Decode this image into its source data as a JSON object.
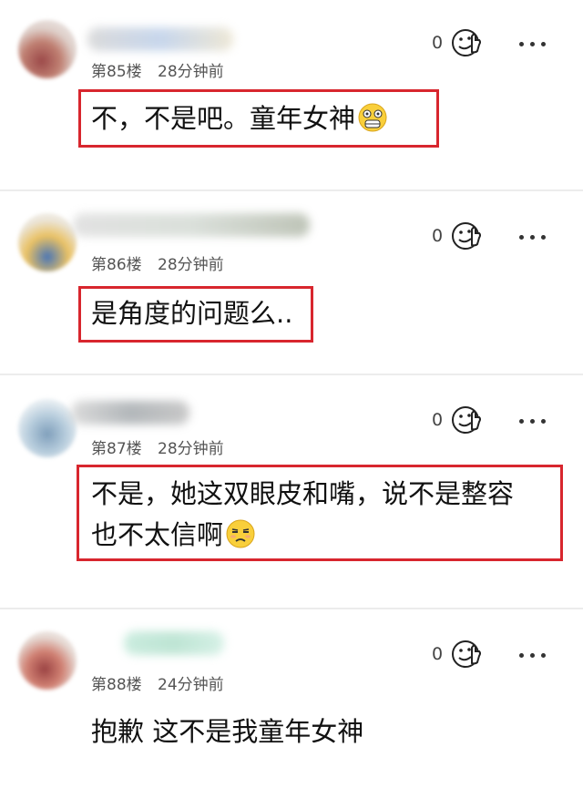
{
  "comments": [
    {
      "floor": "第85楼",
      "time": "28分钟前",
      "likes": "0",
      "lines": [
        "不，不是吧。童年女神"
      ],
      "emoji": "scared-face",
      "highlighted": true
    },
    {
      "floor": "第86楼",
      "time": "28分钟前",
      "likes": "0",
      "lines": [
        "是角度的问题么.."
      ],
      "emoji": null,
      "highlighted": true
    },
    {
      "floor": "第87楼",
      "time": "28分钟前",
      "likes": "0",
      "lines": [
        "不是，她这双眼皮和嘴，说不是整容",
        "也不太信啊"
      ],
      "emoji": "unamused-face",
      "highlighted": true
    },
    {
      "floor": "第88楼",
      "time": "24分钟前",
      "likes": "0",
      "lines": [
        "抱歉 这不是我童年女神"
      ],
      "emoji": null,
      "highlighted": false
    }
  ],
  "colors": {
    "highlight_border": "#d8262e",
    "meta_text": "#555555",
    "divider": "#ececec"
  },
  "icons": {
    "like": "thumbs-up-face-icon",
    "more": "more-dots-icon"
  }
}
